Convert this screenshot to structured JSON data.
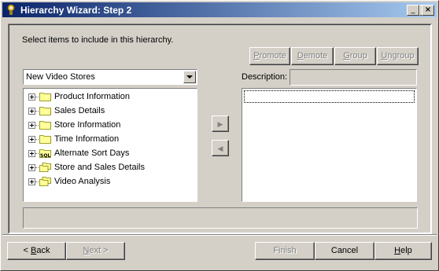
{
  "window": {
    "title": "Hierarchy Wizard: Step 2",
    "controls": {
      "minimize": "_",
      "maximize": "□",
      "close": "×"
    }
  },
  "instructions": "Select items to include in this hierarchy.",
  "actions": {
    "promote": {
      "prefix": "",
      "key": "P",
      "rest": "romote"
    },
    "demote": {
      "prefix": "",
      "key": "D",
      "rest": "emote"
    },
    "group": {
      "prefix": "",
      "key": "G",
      "rest": "roup"
    },
    "ungroup": {
      "prefix": "",
      "key": "U",
      "rest": "ngroup"
    }
  },
  "description_label": "Description:",
  "description_value": "",
  "store_select": {
    "selected": "New Video Stores"
  },
  "tree": {
    "items": [
      {
        "label": "Product Information",
        "icon": "folder-icon"
      },
      {
        "label": "Sales Details",
        "icon": "folder-icon"
      },
      {
        "label": "Store Information",
        "icon": "folder-icon"
      },
      {
        "label": "Time Information",
        "icon": "folder-icon"
      },
      {
        "label": "Alternate Sort Days",
        "icon": "sql-folder-icon",
        "badge": "SQL"
      },
      {
        "label": "Store and Sales Details",
        "icon": "multi-folder-icon"
      },
      {
        "label": "Video Analysis",
        "icon": "multi-folder-icon"
      }
    ]
  },
  "transfer": {
    "add": "▶",
    "remove": "◀"
  },
  "status_text": "",
  "footer": {
    "back": {
      "prefix": "< ",
      "key": "B",
      "rest": "ack"
    },
    "next": {
      "prefix": "",
      "key": "N",
      "rest": "ext >"
    },
    "finish": {
      "prefix": "",
      "key": "",
      "rest": "Finish"
    },
    "cancel": {
      "prefix": "",
      "key": "",
      "rest": "Cancel"
    },
    "help": {
      "prefix": "",
      "key": "H",
      "rest": "elp"
    }
  },
  "colors": {
    "face": "#d4d0c8",
    "title_start": "#0a246a",
    "title_end": "#a6caf0",
    "folder": "#ffff99",
    "disabled_text": "#808080"
  }
}
